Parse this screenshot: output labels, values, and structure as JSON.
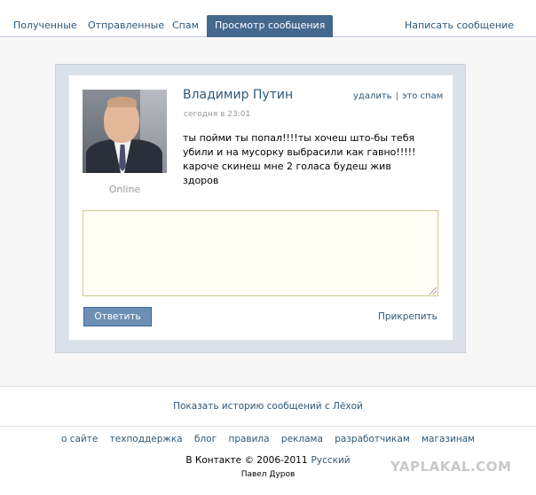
{
  "tabs": [
    {
      "label": "Полученные"
    },
    {
      "label": "Отправленные"
    },
    {
      "label": "Спам"
    },
    {
      "label": "Просмотр сообщения"
    }
  ],
  "write_label": "Написать сообщение",
  "message": {
    "sender": "Владимир Путин",
    "time": "сегодня в 23:01",
    "delete_label": "удалить",
    "separator": "|",
    "spam_label": "это спам",
    "text": "ты пойми ты попал!!!!ты хочеш што-бы тебя убили и на мусорку выбрасили как гавно!!!!!кароче скинеш мне 2 голаса будеш жив здоров",
    "status": "Online"
  },
  "reply": {
    "value": "",
    "button_label": "Ответить",
    "attach_label": "Прикрепить"
  },
  "history_label": "Показать историю сообщений с Лёхой",
  "footer": {
    "links": [
      "о сайте",
      "техподдержка",
      "блог",
      "правила",
      "реклама",
      "разработчикам",
      "магазинам"
    ],
    "copyright": "В Контакте © 2006-2011",
    "language": "Русский",
    "author": "Павел Дуров"
  },
  "watermark": "YAPLAKAL.COM",
  "colors": {
    "accent": "#45688e",
    "link": "#2b587a",
    "button": "#6d8fb3"
  }
}
